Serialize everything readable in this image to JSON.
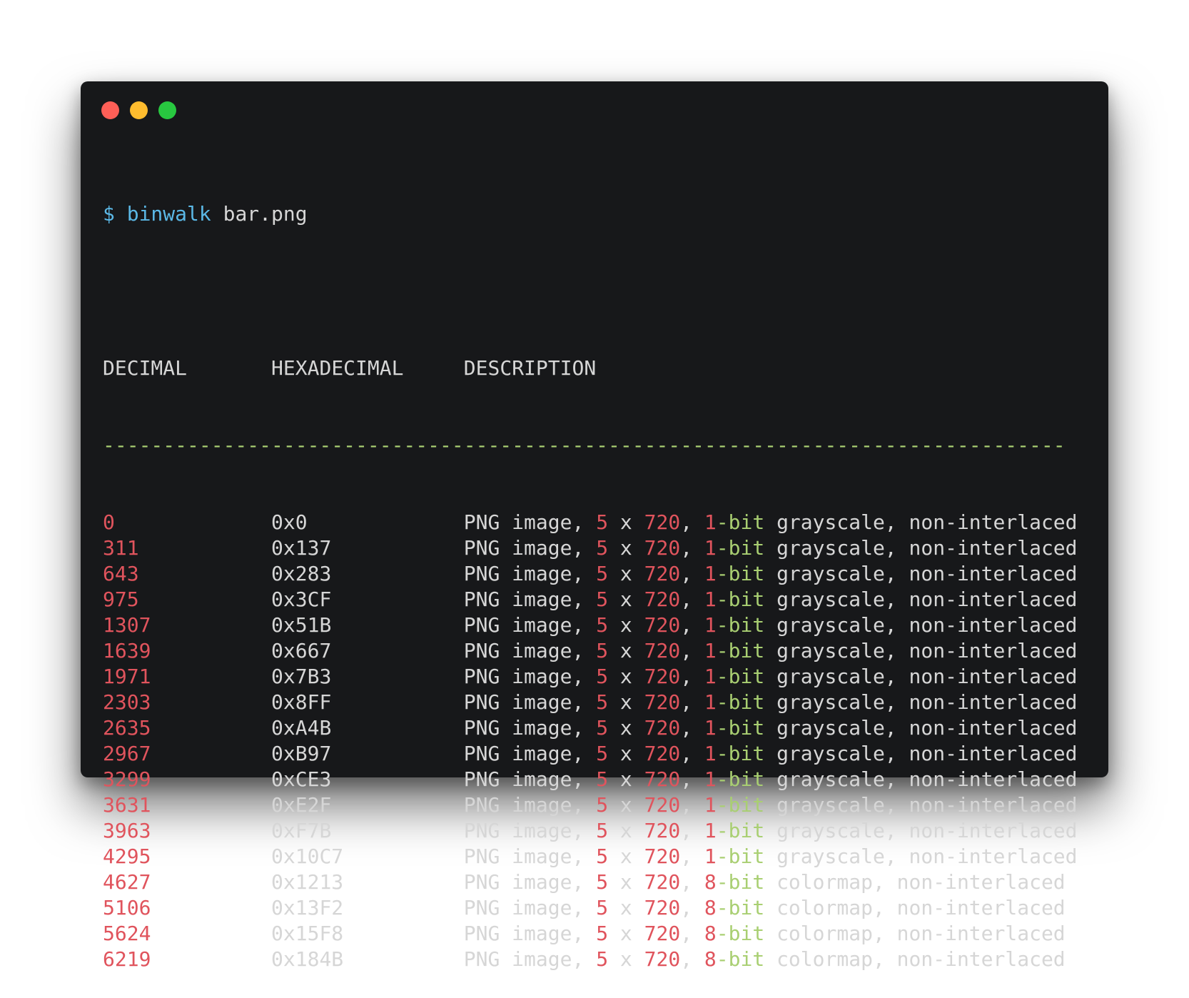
{
  "colors": {
    "window_bg": "#17181a",
    "text": "#d6d6d6",
    "number_red": "#e0545d",
    "green": "#a9cf72",
    "cyan": "#5bb8e6",
    "close": "#fe5f57",
    "minimize": "#febc2e",
    "maximize": "#28c840"
  },
  "prompt": {
    "symbol": "$",
    "command": "binwalk",
    "argument": "bar.png"
  },
  "headers": {
    "decimal": "DECIMAL",
    "hexadecimal": "HEXADECIMAL",
    "description": "DESCRIPTION"
  },
  "separator": "--------------------------------------------------------------------------------",
  "rows": [
    {
      "decimal": "0",
      "hex": "0x0",
      "type": "PNG image",
      "width": "5",
      "x": "x",
      "height": "720",
      "bits": "1",
      "bit_suffix": "-bit",
      "format": "grayscale",
      "interlace": "non-interlaced"
    },
    {
      "decimal": "311",
      "hex": "0x137",
      "type": "PNG image",
      "width": "5",
      "x": "x",
      "height": "720",
      "bits": "1",
      "bit_suffix": "-bit",
      "format": "grayscale",
      "interlace": "non-interlaced"
    },
    {
      "decimal": "643",
      "hex": "0x283",
      "type": "PNG image",
      "width": "5",
      "x": "x",
      "height": "720",
      "bits": "1",
      "bit_suffix": "-bit",
      "format": "grayscale",
      "interlace": "non-interlaced"
    },
    {
      "decimal": "975",
      "hex": "0x3CF",
      "type": "PNG image",
      "width": "5",
      "x": "x",
      "height": "720",
      "bits": "1",
      "bit_suffix": "-bit",
      "format": "grayscale",
      "interlace": "non-interlaced"
    },
    {
      "decimal": "1307",
      "hex": "0x51B",
      "type": "PNG image",
      "width": "5",
      "x": "x",
      "height": "720",
      "bits": "1",
      "bit_suffix": "-bit",
      "format": "grayscale",
      "interlace": "non-interlaced"
    },
    {
      "decimal": "1639",
      "hex": "0x667",
      "type": "PNG image",
      "width": "5",
      "x": "x",
      "height": "720",
      "bits": "1",
      "bit_suffix": "-bit",
      "format": "grayscale",
      "interlace": "non-interlaced"
    },
    {
      "decimal": "1971",
      "hex": "0x7B3",
      "type": "PNG image",
      "width": "5",
      "x": "x",
      "height": "720",
      "bits": "1",
      "bit_suffix": "-bit",
      "format": "grayscale",
      "interlace": "non-interlaced"
    },
    {
      "decimal": "2303",
      "hex": "0x8FF",
      "type": "PNG image",
      "width": "5",
      "x": "x",
      "height": "720",
      "bits": "1",
      "bit_suffix": "-bit",
      "format": "grayscale",
      "interlace": "non-interlaced"
    },
    {
      "decimal": "2635",
      "hex": "0xA4B",
      "type": "PNG image",
      "width": "5",
      "x": "x",
      "height": "720",
      "bits": "1",
      "bit_suffix": "-bit",
      "format": "grayscale",
      "interlace": "non-interlaced"
    },
    {
      "decimal": "2967",
      "hex": "0xB97",
      "type": "PNG image",
      "width": "5",
      "x": "x",
      "height": "720",
      "bits": "1",
      "bit_suffix": "-bit",
      "format": "grayscale",
      "interlace": "non-interlaced"
    },
    {
      "decimal": "3299",
      "hex": "0xCE3",
      "type": "PNG image",
      "width": "5",
      "x": "x",
      "height": "720",
      "bits": "1",
      "bit_suffix": "-bit",
      "format": "grayscale",
      "interlace": "non-interlaced"
    },
    {
      "decimal": "3631",
      "hex": "0xE2F",
      "type": "PNG image",
      "width": "5",
      "x": "x",
      "height": "720",
      "bits": "1",
      "bit_suffix": "-bit",
      "format": "grayscale",
      "interlace": "non-interlaced"
    },
    {
      "decimal": "3963",
      "hex": "0xF7B",
      "type": "PNG image",
      "width": "5",
      "x": "x",
      "height": "720",
      "bits": "1",
      "bit_suffix": "-bit",
      "format": "grayscale",
      "interlace": "non-interlaced"
    },
    {
      "decimal": "4295",
      "hex": "0x10C7",
      "type": "PNG image",
      "width": "5",
      "x": "x",
      "height": "720",
      "bits": "1",
      "bit_suffix": "-bit",
      "format": "grayscale",
      "interlace": "non-interlaced"
    },
    {
      "decimal": "4627",
      "hex": "0x1213",
      "type": "PNG image",
      "width": "5",
      "x": "x",
      "height": "720",
      "bits": "8",
      "bit_suffix": "-bit",
      "format": "colormap",
      "interlace": "non-interlaced"
    },
    {
      "decimal": "5106",
      "hex": "0x13F2",
      "type": "PNG image",
      "width": "5",
      "x": "x",
      "height": "720",
      "bits": "8",
      "bit_suffix": "-bit",
      "format": "colormap",
      "interlace": "non-interlaced"
    },
    {
      "decimal": "5624",
      "hex": "0x15F8",
      "type": "PNG image",
      "width": "5",
      "x": "x",
      "height": "720",
      "bits": "8",
      "bit_suffix": "-bit",
      "format": "colormap",
      "interlace": "non-interlaced"
    },
    {
      "decimal": "6219",
      "hex": "0x184B",
      "type": "PNG image",
      "width": "5",
      "x": "x",
      "height": "720",
      "bits": "8",
      "bit_suffix": "-bit",
      "format": "colormap",
      "interlace": "non-interlaced"
    }
  ]
}
